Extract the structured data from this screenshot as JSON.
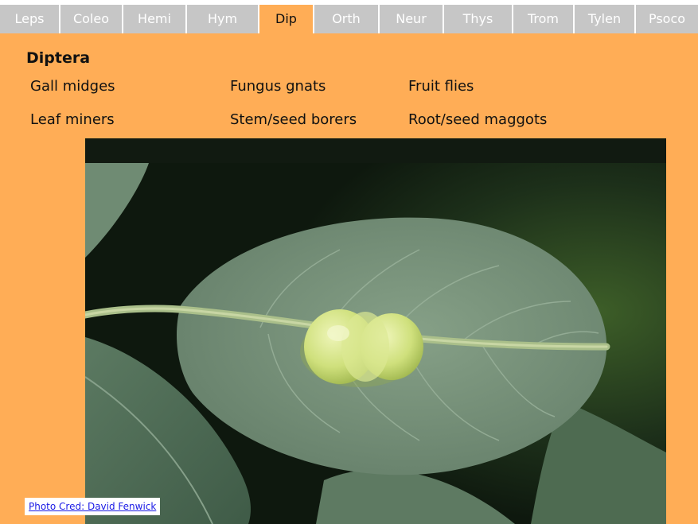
{
  "tabs": [
    {
      "label": "Leps"
    },
    {
      "label": "Coleo"
    },
    {
      "label": "Hemi"
    },
    {
      "label": "Hym"
    },
    {
      "label": "Dip"
    },
    {
      "label": "Orth"
    },
    {
      "label": "Neur"
    },
    {
      "label": "Thys"
    },
    {
      "label": "Trom"
    },
    {
      "label": "Tylen"
    },
    {
      "label": "Psoco"
    }
  ],
  "active_tab": "Dip",
  "section": {
    "title": "Diptera",
    "categories": [
      {
        "label": "Gall midges"
      },
      {
        "label": "Fungus gnats"
      },
      {
        "label": "Fruit flies"
      },
      {
        "label": "Leaf miners"
      },
      {
        "label": "Stem/seed borers"
      },
      {
        "label": "Root/seed maggots"
      }
    ]
  },
  "photo": {
    "credit": "Photo Cred: David Fenwick"
  },
  "colors": {
    "background": "#ffad56",
    "tab_inactive": "#c6c6c6",
    "tab_text_inactive": "#ffffff",
    "credit_link": "#1a1ae6"
  }
}
